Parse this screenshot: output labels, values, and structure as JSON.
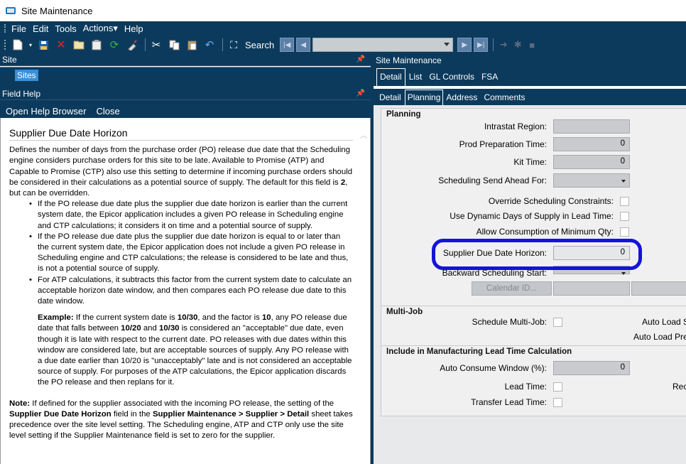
{
  "window": {
    "title": "Site Maintenance"
  },
  "menu": [
    "File",
    "Edit",
    "Tools",
    "Actions▾",
    "Help"
  ],
  "toolbar": {
    "search_label": "Search"
  },
  "left": {
    "site_panel_title": "Site",
    "sites_node": "Sites",
    "field_help_title": "Field Help",
    "open_help": "Open Help Browser",
    "close": "Close",
    "help": {
      "heading": "Supplier Due Date Horizon",
      "intro_a": "Defines the number of days from the purchase order (PO) release due date that the Scheduling engine considers purchase orders for this site to be late. Available to Promise (ATP) and Capable to Promise (CTP) also use this setting to determine if incoming purchase orders should be considered in their calculations as a potential source of supply. The default for this field is ",
      "intro_bold": "2",
      "intro_b": ", but can be overridden.",
      "bullets": [
        "If the PO release due date plus the supplier due date horizon is earlier than the current system date, the Epicor application includes a given PO release in Scheduling engine and CTP calculations; it considers it on time and a potential source of supply.",
        "If the PO release due date plus the supplier due date horizon is equal to or later than the current system date, the Epicor application does not include a given PO release in Scheduling engine and CTP calculations; the release is considered to be late and thus, is not a potential source of supply.",
        "For ATP calculations, it subtracts this factor from the current system date to calculate an acceptable horizon date window, and then compares each PO release due date to this date window."
      ],
      "example_label": "Example:",
      "example_1": " If the current system date is ",
      "example_date": "10/30",
      "example_2": ", and the factor is ",
      "example_factor": "10",
      "example_3": ", any PO release due date that falls between ",
      "example_range_a": "10/20",
      "example_4": " and ",
      "example_range_b": "10/30",
      "example_5": " is considered an \"acceptable\" due date, even though it is late with respect to the current date. PO releases with due dates within this window are considered late, but are acceptable sources of supply. Any PO release with a due date earlier than 10/20 is \"unacceptably\" late and is not considered an acceptable source of supply. For purposes of the ATP calculations, the Epicor application discards the PO release and then replans for it.",
      "note_label": "Note:",
      "note_1": " If defined for the supplier associated with the incoming PO release, the setting of the ",
      "note_field": "Supplier Due Date Horizon",
      "note_2": " field in the ",
      "note_path": "Supplier Maintenance > Supplier > Detail",
      "note_3": " sheet takes precedence over the site level setting. The Scheduling engine, ATP and CTP only use the site level setting if the Supplier Maintenance field is set to zero for the supplier."
    }
  },
  "right": {
    "panel_title": "Site Maintenance",
    "tabs1": [
      "Detail",
      "List",
      "GL Controls",
      "FSA"
    ],
    "tabs2": [
      "Detail",
      "Planning",
      "Address",
      "Comments"
    ],
    "planning": {
      "title": "Planning",
      "intrastat": "Intrastat Region:",
      "prod_prep": "Prod Preparation Time:",
      "prod_prep_value": "0",
      "kit_time": "Kit Time:",
      "kit_time_value": "0",
      "send_ahead": "Scheduling Send Ahead For:",
      "override": "Override Scheduling Constraints:",
      "dynamic_days": "Use Dynamic Days of Supply in Lead Time:",
      "allow_min": "Allow Consumption of Minimum Qty:",
      "supplier_horizon": "Supplier Due Date Horizon:",
      "supplier_horizon_value": "0",
      "backward": "Backward Scheduling Start:",
      "calendar_btn": "Calendar ID..."
    },
    "multijob": {
      "title": "Multi-Job",
      "schedule": "Schedule Multi-Job:",
      "auto_load_s": "Auto Load S",
      "auto_load_pr": "Auto Load Pre"
    },
    "leadtime": {
      "title": "Include in Manufacturing Lead Time Calculation",
      "auto_consume": "Auto Consume Window (%):",
      "auto_consume_value": "0",
      "lead_time": "Lead Time:",
      "rec": "Rec",
      "transfer": "Transfer Lead Time:"
    }
  }
}
